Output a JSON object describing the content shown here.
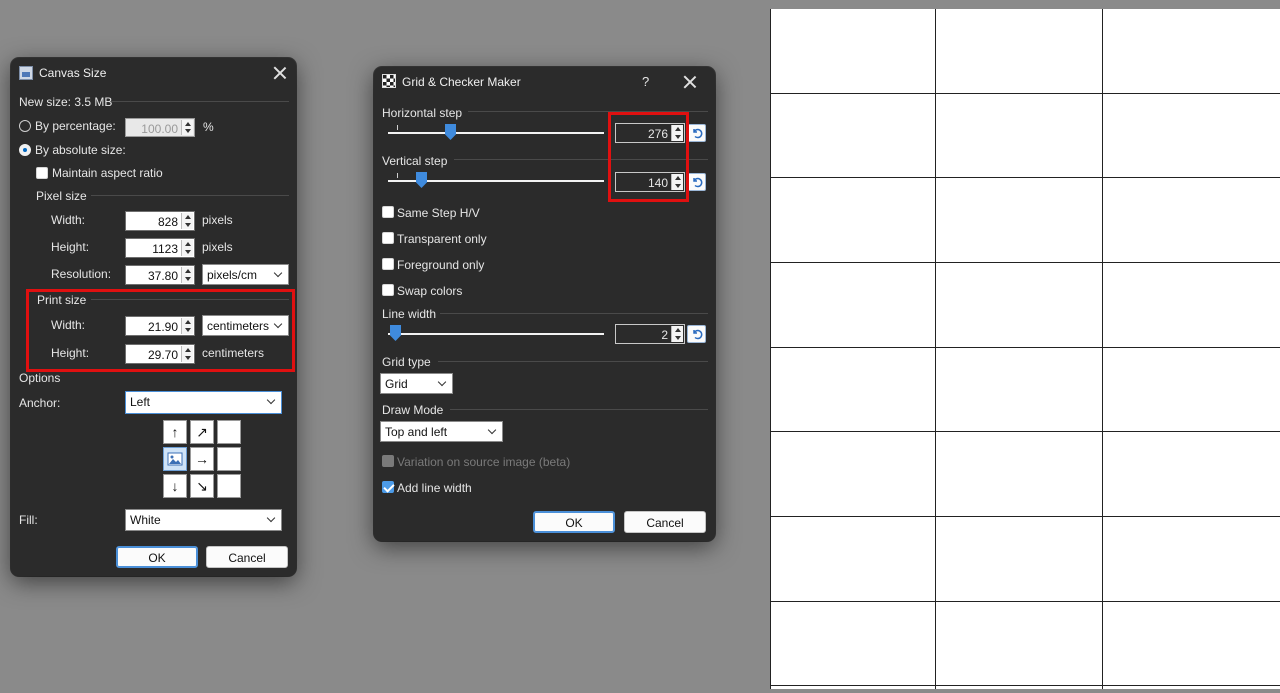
{
  "canvas_dialog": {
    "title": "Canvas Size",
    "new_size": "New size: 3.5 MB",
    "by_percentage_label": "By percentage:",
    "percentage_value": "100.00",
    "percent_unit": "%",
    "by_absolute_label": "By absolute size:",
    "maintain_aspect_label": "Maintain aspect ratio",
    "pixel_size_heading": "Pixel size",
    "width_label": "Width:",
    "height_label": "Height:",
    "resolution_label": "Resolution:",
    "pixel_width": "828",
    "pixel_height": "1123",
    "resolution": "37.80",
    "pixels_unit": "pixels",
    "resolution_unit": "pixels/cm",
    "print_size_heading": "Print size",
    "print_width": "21.90",
    "print_height": "29.70",
    "print_width_unit": "centimeters",
    "print_height_unit": "centimeters",
    "options_heading": "Options",
    "anchor_label": "Anchor:",
    "anchor_value": "Left",
    "fill_label": "Fill:",
    "fill_value": "White",
    "ok_label": "OK",
    "cancel_label": "Cancel",
    "anchor_grid": [
      "↑",
      "↗",
      "",
      "",
      "→",
      "",
      "↓",
      "↘",
      ""
    ]
  },
  "grid_dialog": {
    "title": "Grid & Checker Maker",
    "help_label": "?",
    "horizontal_step_label": "Horizontal step",
    "horizontal_step_value": "276",
    "vertical_step_label": "Vertical step",
    "vertical_step_value": "140",
    "same_step_label": "Same Step H/V",
    "transparent_only_label": "Transparent only",
    "foreground_only_label": "Foreground only",
    "swap_colors_label": "Swap colors",
    "line_width_label": "Line width",
    "line_width_value": "2",
    "grid_type_label": "Grid type",
    "grid_type_value": "Grid",
    "draw_mode_label": "Draw Mode",
    "draw_mode_value": "Top and left",
    "variation_label": "Variation on source image (beta)",
    "add_line_width_label": "Add line width",
    "ok_label": "OK",
    "cancel_label": "Cancel"
  },
  "colors": {
    "dialog_bg": "#2b2b2b",
    "highlight": "#e01010",
    "accent": "#3f8bde"
  },
  "icons": [
    "canvas-size-app-icon",
    "grid-checker-app-icon",
    "close-icon",
    "reset-icon",
    "landscape-image-icon"
  ]
}
